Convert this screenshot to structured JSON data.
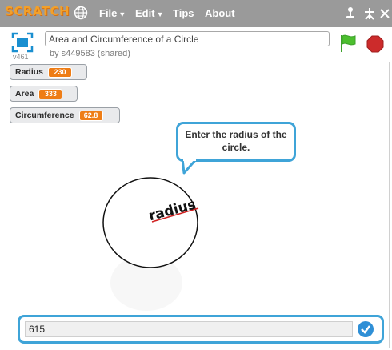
{
  "menubar": {
    "logo_text": "SCRATCH",
    "items": [
      {
        "label": "File",
        "has_caret": true
      },
      {
        "label": "Edit",
        "has_caret": true
      },
      {
        "label": "Tips",
        "has_caret": false
      },
      {
        "label": "About",
        "has_caret": false
      }
    ],
    "icons": [
      "globe-icon",
      "duplicate-icon",
      "cut-icon",
      "grow-icon",
      "shrink-icon"
    ]
  },
  "header": {
    "version": "v461",
    "project_title": "Area and Circumference of a Circle",
    "byline": "by s449583 (shared)"
  },
  "monitors": [
    {
      "label": "Radius",
      "value": "230"
    },
    {
      "label": "Area",
      "value": "333"
    },
    {
      "label": "Circumference",
      "value": "62.8"
    }
  ],
  "sprite": {
    "speech": "Enter the radius of the circle.",
    "drawing_label": "radius"
  },
  "ask": {
    "answer_value": "615"
  },
  "colors": {
    "menubar": "#9a9a9a",
    "monitor_value": "#ee7d16",
    "bubble_border": "#3fa4d8",
    "green_flag": "#4cbf2e",
    "stop": "#cc2b2b"
  }
}
